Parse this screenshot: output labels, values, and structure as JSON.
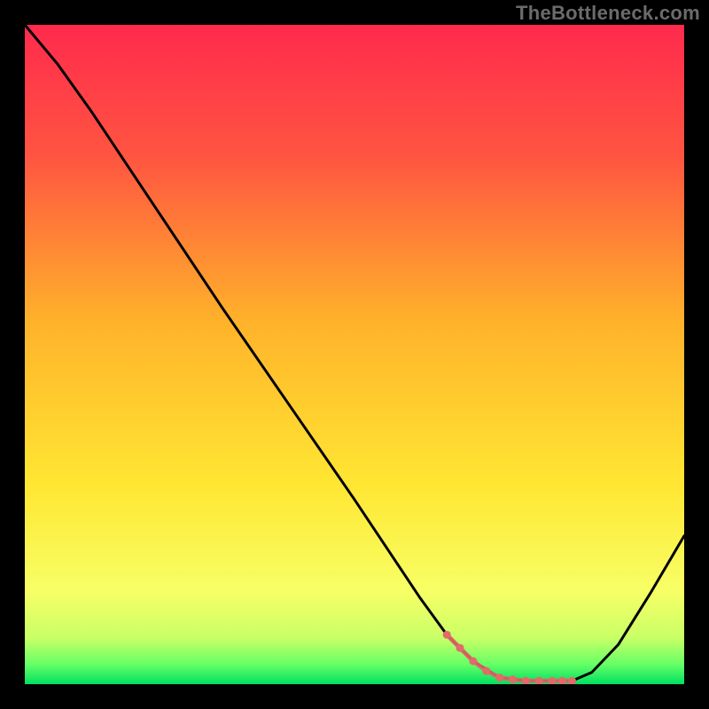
{
  "watermark": "TheBottleneck.com",
  "chart_data": {
    "type": "line",
    "title": "",
    "xlabel": "",
    "ylabel": "",
    "xlim": [
      0,
      1
    ],
    "ylim": [
      0,
      1
    ],
    "background_gradient_stops": [
      {
        "offset": 0.0,
        "color": "#ff2a4d"
      },
      {
        "offset": 0.2,
        "color": "#ff5541"
      },
      {
        "offset": 0.45,
        "color": "#ffb22a"
      },
      {
        "offset": 0.7,
        "color": "#ffe733"
      },
      {
        "offset": 0.86,
        "color": "#f7ff66"
      },
      {
        "offset": 0.93,
        "color": "#c9ff66"
      },
      {
        "offset": 0.97,
        "color": "#66ff66"
      },
      {
        "offset": 1.0,
        "color": "#00e060"
      }
    ],
    "series": [
      {
        "name": "bottleneck-curve",
        "color": "#000000",
        "x": [
          0.0,
          0.05,
          0.1,
          0.14,
          0.2,
          0.3,
          0.4,
          0.5,
          0.6,
          0.64,
          0.68,
          0.72,
          0.76,
          0.8,
          0.83,
          0.86,
          0.9,
          0.95,
          1.0
        ],
        "y": [
          1.0,
          0.94,
          0.87,
          0.81,
          0.72,
          0.57,
          0.425,
          0.28,
          0.13,
          0.075,
          0.035,
          0.01,
          0.005,
          0.005,
          0.005,
          0.018,
          0.06,
          0.14,
          0.225
        ]
      }
    ],
    "markers": {
      "name": "valley-highlight",
      "color": "#e26a6a",
      "x": [
        0.64,
        0.66,
        0.68,
        0.7,
        0.72,
        0.74,
        0.76,
        0.78,
        0.8,
        0.815,
        0.83
      ],
      "y": [
        0.075,
        0.055,
        0.035,
        0.02,
        0.01,
        0.007,
        0.005,
        0.005,
        0.005,
        0.005,
        0.005
      ]
    }
  }
}
